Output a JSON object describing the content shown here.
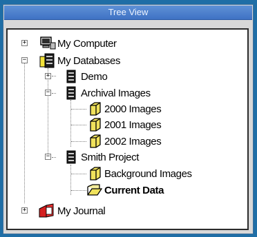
{
  "window": {
    "title": "Tree View"
  },
  "tree": {
    "my_computer": {
      "label": "My Computer",
      "expander": "+"
    },
    "my_databases": {
      "label": "My Databases",
      "expander": "−"
    },
    "demo": {
      "label": "Demo",
      "expander": "+"
    },
    "archival_images": {
      "label": "Archival Images",
      "expander": "−"
    },
    "img_2000": {
      "label": "2000 Images"
    },
    "img_2001": {
      "label": "2001 Images"
    },
    "img_2002": {
      "label": "2002 Images"
    },
    "smith_project": {
      "label": "Smith Project",
      "expander": "−"
    },
    "background_images": {
      "label": "Background Images"
    },
    "current_data": {
      "label": "Current Data",
      "selected": true
    },
    "my_journal": {
      "label": "My Journal",
      "expander": "+"
    }
  }
}
